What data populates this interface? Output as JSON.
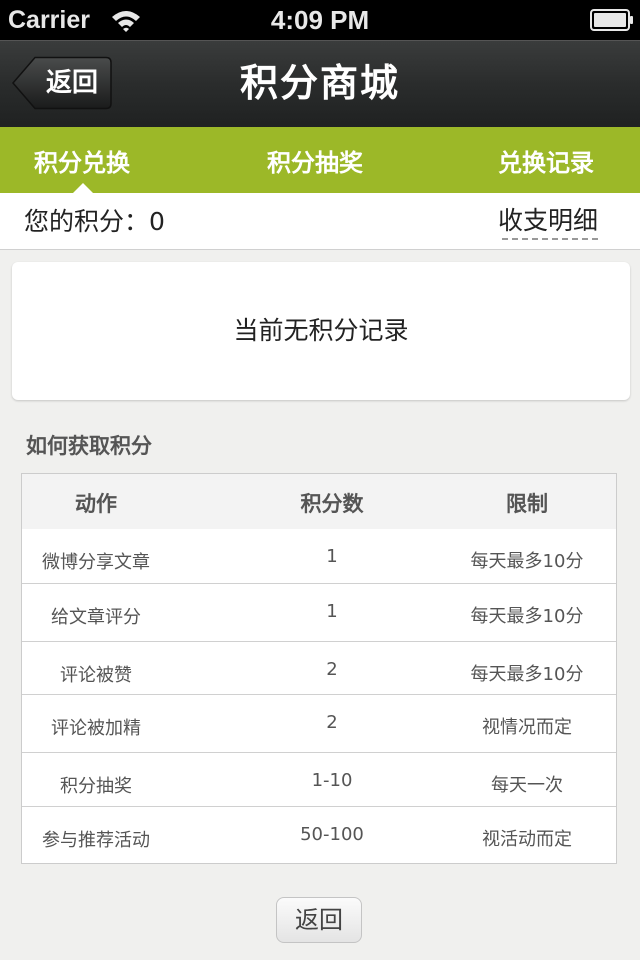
{
  "status_bar": {
    "carrier": "Carrier",
    "time": "4:09 PM"
  },
  "nav": {
    "back_label": "返回",
    "title": "积分商城"
  },
  "tabs": [
    {
      "label": "积分兑换",
      "active": true
    },
    {
      "label": "积分抽奖",
      "active": false
    },
    {
      "label": "兑换记录",
      "active": false
    }
  ],
  "points": {
    "label": "您的积分：0",
    "details_link": "收支明细"
  },
  "records": {
    "empty_text": "当前无积分记录"
  },
  "how_to": {
    "title": "如何获取积分",
    "headers": [
      "动作",
      "积分数",
      "限制"
    ],
    "rows": [
      [
        "微博分享文章",
        "1",
        "每天最多10分"
      ],
      [
        "给文章评分",
        "1",
        "每天最多10分"
      ],
      [
        "评论被赞",
        "2",
        "每天最多10分"
      ],
      [
        "评论被加精",
        "2",
        "视情况而定"
      ],
      [
        "积分抽奖",
        "1-10",
        "每天一次"
      ],
      [
        "参与推荐活动",
        "50-100",
        "视活动而定"
      ]
    ]
  },
  "bottom": {
    "back_label": "返回"
  },
  "colors": {
    "accent_green": "#9cb828",
    "nav_dark": "#2a2c2c"
  }
}
